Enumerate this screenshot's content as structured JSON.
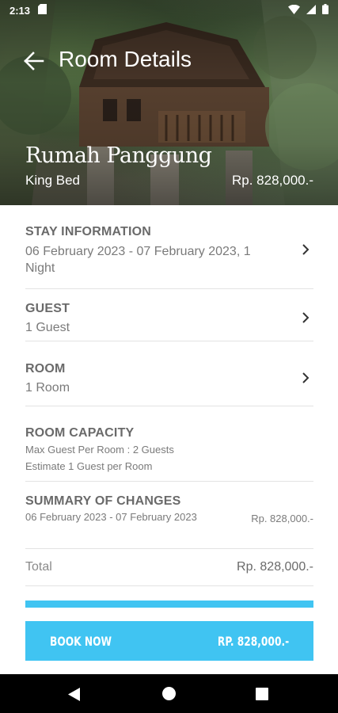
{
  "status_bar": {
    "time": "2:13"
  },
  "header": {
    "title": "Room Details"
  },
  "hero": {
    "room_name": "Rumah Panggung",
    "bed_type": "King Bed",
    "price": "Rp. 828,000.-"
  },
  "stay": {
    "heading": "STAY INFORMATION",
    "value": "06 February 2023 - 07 February 2023, 1 Night"
  },
  "guest": {
    "heading": "GUEST",
    "value": "1 Guest"
  },
  "room": {
    "heading": "ROOM",
    "value": "1 Room"
  },
  "capacity": {
    "heading": "ROOM CAPACITY",
    "line1": "Max Guest Per Room : 2 Guests",
    "line2": "Estimate 1 Guest per Room"
  },
  "summary": {
    "heading": "SUMMARY OF CHANGES",
    "dates": "06 February 2023 - 07 February 2023",
    "price": "Rp. 828,000.-"
  },
  "total": {
    "label": "Total",
    "value": "Rp. 828,000.-"
  },
  "book": {
    "label": "BOOK NOW",
    "price": "RP. 828,000.-"
  },
  "colors": {
    "accent": "#40c4f2"
  }
}
